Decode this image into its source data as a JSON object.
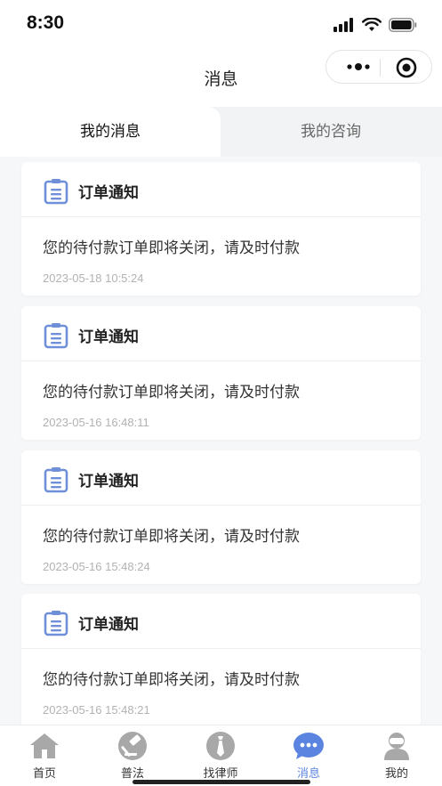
{
  "status_bar": {
    "time": "8:30"
  },
  "nav": {
    "title": "消息"
  },
  "tabs": [
    {
      "label": "我的消息",
      "active": true
    },
    {
      "label": "我的咨询",
      "active": false
    }
  ],
  "messages": [
    {
      "title": "订单通知",
      "body": "您的待付款订单即将关闭，请及时付款",
      "time": "2023-05-18 10:5:24"
    },
    {
      "title": "订单通知",
      "body": "您的待付款订单即将关闭，请及时付款",
      "time": "2023-05-16 16:48:11"
    },
    {
      "title": "订单通知",
      "body": "您的待付款订单即将关闭，请及时付款",
      "time": "2023-05-16 15:48:24"
    },
    {
      "title": "订单通知",
      "body": "您的待付款订单即将关闭，请及时付款",
      "time": "2023-05-16 15:48:21"
    }
  ],
  "tabbar": [
    {
      "label": "首页",
      "icon": "home-icon"
    },
    {
      "label": "普法",
      "icon": "gavel-icon"
    },
    {
      "label": "找律师",
      "icon": "lawyer-tie-icon"
    },
    {
      "label": "消息",
      "icon": "chat-bubble-icon",
      "active": true
    },
    {
      "label": "我的",
      "icon": "profile-icon"
    }
  ],
  "colors": {
    "accent": "#5b84e0",
    "icon_gray": "#a8a8a8",
    "card_icon": "#6f8fd8"
  }
}
